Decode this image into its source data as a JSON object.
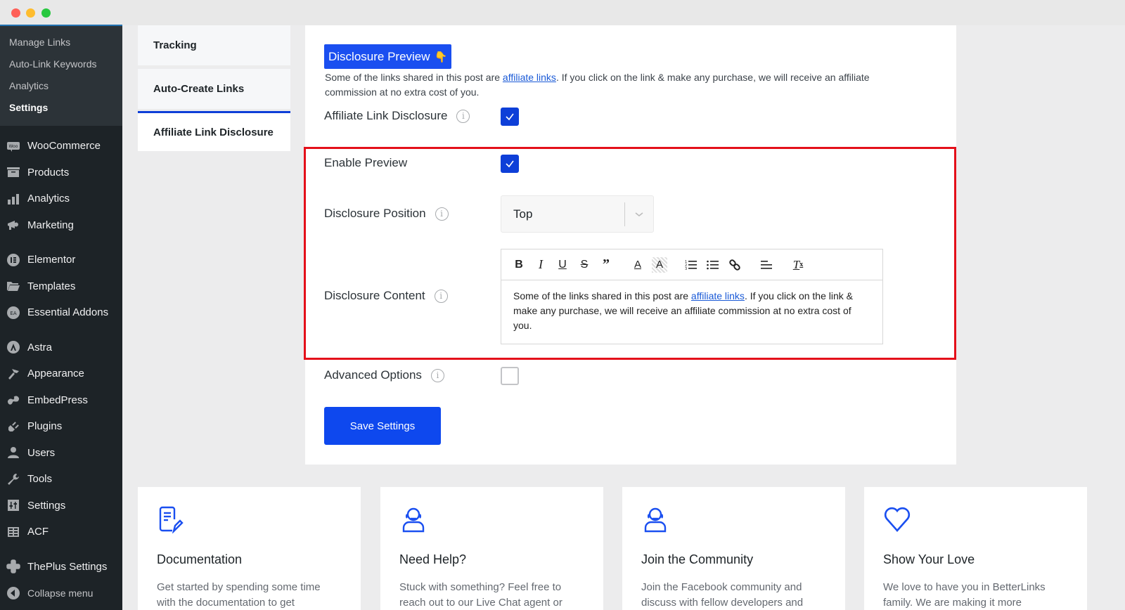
{
  "window": {
    "controls": [
      "close",
      "minimize",
      "maximize"
    ]
  },
  "sidebar": {
    "submenu": [
      {
        "label": "Manage Links",
        "current": false
      },
      {
        "label": "Auto-Link Keywords",
        "current": false
      },
      {
        "label": "Analytics",
        "current": false
      },
      {
        "label": "Settings",
        "current": true
      }
    ],
    "menu": [
      {
        "label": "WooCommerce",
        "icon": "woocommerce-icon"
      },
      {
        "label": "Products",
        "icon": "archive-box-icon"
      },
      {
        "label": "Analytics",
        "icon": "bar-chart-icon"
      },
      {
        "label": "Marketing",
        "icon": "megaphone-icon"
      },
      {
        "label": "Elementor",
        "icon": "elementor-icon"
      },
      {
        "label": "Templates",
        "icon": "folder-icon"
      },
      {
        "label": "Essential Addons",
        "icon": "essential-addons-icon"
      },
      {
        "label": "Astra",
        "icon": "astra-icon"
      },
      {
        "label": "Appearance",
        "icon": "paintbrush-icon"
      },
      {
        "label": "EmbedPress",
        "icon": "embedpress-icon"
      },
      {
        "label": "Plugins",
        "icon": "plug-icon"
      },
      {
        "label": "Users",
        "icon": "user-icon"
      },
      {
        "label": "Tools",
        "icon": "wrench-icon"
      },
      {
        "label": "Settings",
        "icon": "sliders-icon"
      },
      {
        "label": "ACF",
        "icon": "table-icon"
      },
      {
        "label": "ThePlus Settings",
        "icon": "theplus-icon"
      },
      {
        "label": "Collapse menu",
        "icon": "collapse-arrow-icon"
      }
    ]
  },
  "tabs": [
    {
      "label": "Tracking",
      "active": false
    },
    {
      "label": "Auto-Create Links",
      "active": false
    },
    {
      "label": "Affiliate Link Disclosure",
      "active": true
    }
  ],
  "preview": {
    "badge_label": "Disclosure Preview",
    "badge_emoji": "👇",
    "text_before": "Some of the links shared in this post are ",
    "link_text": "affiliate links",
    "text_after": ". If you click on the link & make any purchase, we will receive an affiliate commission at no extra cost of you."
  },
  "settings": {
    "affiliate_link_disclosure": {
      "label": "Affiliate Link Disclosure",
      "checked": true
    },
    "enable_preview": {
      "label": "Enable Preview",
      "checked": true
    },
    "disclosure_position": {
      "label": "Disclosure Position",
      "value": "Top"
    },
    "disclosure_content": {
      "label": "Disclosure Content",
      "toolbar": [
        "bold",
        "italic",
        "underline",
        "strikethrough",
        "blockquote",
        "text-color",
        "background-color",
        "ordered-list",
        "bullet-list",
        "link",
        "align",
        "clear-formatting"
      ],
      "text_before": "Some of the links shared in this post are ",
      "link_text": "affiliate links",
      "text_after": ". If you click on the link & make any purchase, we will receive an affiliate commission at no extra cost of you."
    },
    "advanced_options": {
      "label": "Advanced Options",
      "checked": false
    },
    "save_label": "Save Settings"
  },
  "cards": [
    {
      "title": "Documentation",
      "icon": "document-edit-icon",
      "text": "Get started by spending some time with the documentation to get"
    },
    {
      "title": "Need Help?",
      "icon": "support-agent-icon",
      "text": "Stuck with something? Feel free to reach out to our Live Chat agent or"
    },
    {
      "title": "Join the Community",
      "icon": "community-icon",
      "text": "Join the Facebook community and discuss with fellow developers and"
    },
    {
      "title": "Show Your Love",
      "icon": "heart-icon",
      "text": "We love to have you in BetterLinks family. We are making it more"
    }
  ],
  "colors": {
    "accent": "#0e48ee",
    "highlight_border": "#e4101a",
    "sidebar_bg": "#1d2327"
  }
}
